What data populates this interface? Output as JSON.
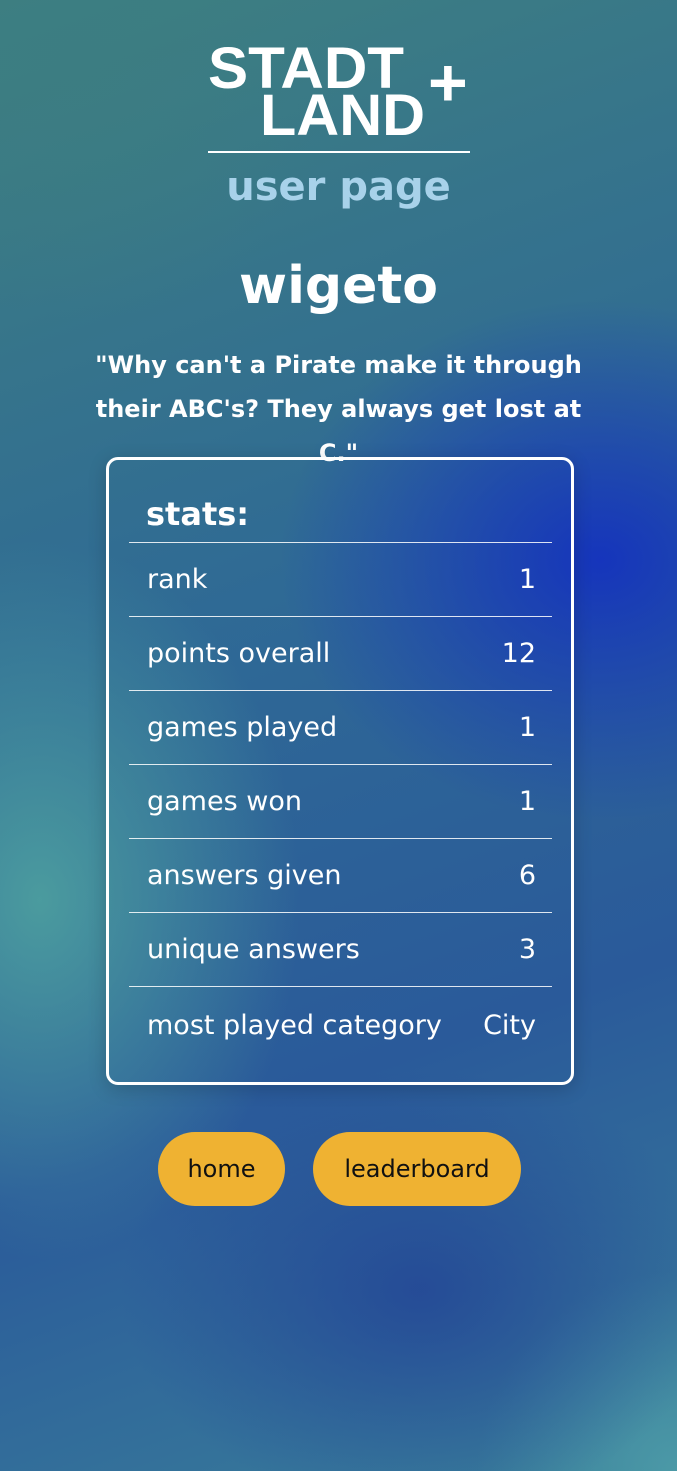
{
  "logo": {
    "line1": "STADT",
    "line2": "LAND",
    "plus": "+"
  },
  "page": {
    "subtitle": "user page"
  },
  "user": {
    "name": "wigeto",
    "quote": "\"Why can't a Pirate make it through their ABC's? They always get lost at C.\""
  },
  "stats": {
    "title": "stats:",
    "rows": [
      {
        "label": "rank",
        "value": "1"
      },
      {
        "label": "points overall",
        "value": "12"
      },
      {
        "label": "games played",
        "value": "1"
      },
      {
        "label": "games won",
        "value": "1"
      },
      {
        "label": "answers given",
        "value": "6"
      },
      {
        "label": "unique answers",
        "value": "3"
      },
      {
        "label": "most played category",
        "value": "City"
      }
    ]
  },
  "nav": {
    "home_label": "home",
    "leaderboard_label": "leaderboard"
  },
  "colors": {
    "button_bg": "#efb232",
    "subtitle_color": "#a8d2ea",
    "accent_blue": "#1432be"
  }
}
